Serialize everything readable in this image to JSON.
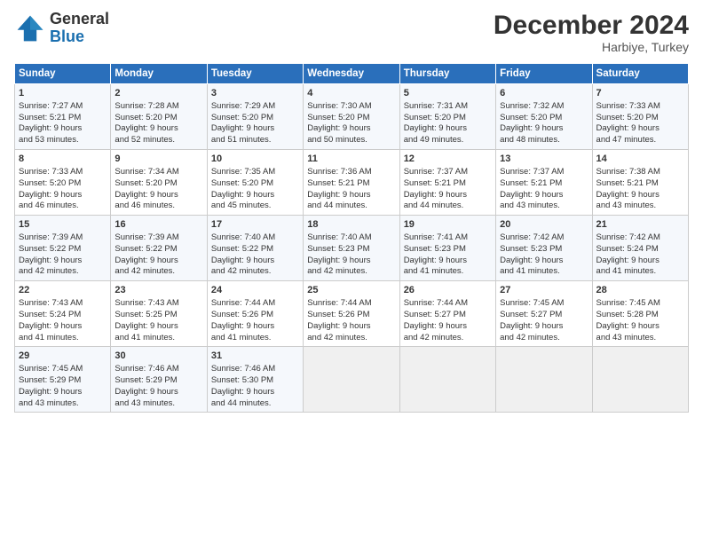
{
  "header": {
    "logo_text_general": "General",
    "logo_text_blue": "Blue",
    "month_title": "December 2024",
    "subtitle": "Harbiye, Turkey"
  },
  "columns": [
    "Sunday",
    "Monday",
    "Tuesday",
    "Wednesday",
    "Thursday",
    "Friday",
    "Saturday"
  ],
  "weeks": [
    [
      {
        "day": "1",
        "lines": [
          "Sunrise: 7:27 AM",
          "Sunset: 5:21 PM",
          "Daylight: 9 hours",
          "and 53 minutes."
        ]
      },
      {
        "day": "2",
        "lines": [
          "Sunrise: 7:28 AM",
          "Sunset: 5:20 PM",
          "Daylight: 9 hours",
          "and 52 minutes."
        ]
      },
      {
        "day": "3",
        "lines": [
          "Sunrise: 7:29 AM",
          "Sunset: 5:20 PM",
          "Daylight: 9 hours",
          "and 51 minutes."
        ]
      },
      {
        "day": "4",
        "lines": [
          "Sunrise: 7:30 AM",
          "Sunset: 5:20 PM",
          "Daylight: 9 hours",
          "and 50 minutes."
        ]
      },
      {
        "day": "5",
        "lines": [
          "Sunrise: 7:31 AM",
          "Sunset: 5:20 PM",
          "Daylight: 9 hours",
          "and 49 minutes."
        ]
      },
      {
        "day": "6",
        "lines": [
          "Sunrise: 7:32 AM",
          "Sunset: 5:20 PM",
          "Daylight: 9 hours",
          "and 48 minutes."
        ]
      },
      {
        "day": "7",
        "lines": [
          "Sunrise: 7:33 AM",
          "Sunset: 5:20 PM",
          "Daylight: 9 hours",
          "and 47 minutes."
        ]
      }
    ],
    [
      {
        "day": "8",
        "lines": [
          "Sunrise: 7:33 AM",
          "Sunset: 5:20 PM",
          "Daylight: 9 hours",
          "and 46 minutes."
        ]
      },
      {
        "day": "9",
        "lines": [
          "Sunrise: 7:34 AM",
          "Sunset: 5:20 PM",
          "Daylight: 9 hours",
          "and 46 minutes."
        ]
      },
      {
        "day": "10",
        "lines": [
          "Sunrise: 7:35 AM",
          "Sunset: 5:20 PM",
          "Daylight: 9 hours",
          "and 45 minutes."
        ]
      },
      {
        "day": "11",
        "lines": [
          "Sunrise: 7:36 AM",
          "Sunset: 5:21 PM",
          "Daylight: 9 hours",
          "and 44 minutes."
        ]
      },
      {
        "day": "12",
        "lines": [
          "Sunrise: 7:37 AM",
          "Sunset: 5:21 PM",
          "Daylight: 9 hours",
          "and 44 minutes."
        ]
      },
      {
        "day": "13",
        "lines": [
          "Sunrise: 7:37 AM",
          "Sunset: 5:21 PM",
          "Daylight: 9 hours",
          "and 43 minutes."
        ]
      },
      {
        "day": "14",
        "lines": [
          "Sunrise: 7:38 AM",
          "Sunset: 5:21 PM",
          "Daylight: 9 hours",
          "and 43 minutes."
        ]
      }
    ],
    [
      {
        "day": "15",
        "lines": [
          "Sunrise: 7:39 AM",
          "Sunset: 5:22 PM",
          "Daylight: 9 hours",
          "and 42 minutes."
        ]
      },
      {
        "day": "16",
        "lines": [
          "Sunrise: 7:39 AM",
          "Sunset: 5:22 PM",
          "Daylight: 9 hours",
          "and 42 minutes."
        ]
      },
      {
        "day": "17",
        "lines": [
          "Sunrise: 7:40 AM",
          "Sunset: 5:22 PM",
          "Daylight: 9 hours",
          "and 42 minutes."
        ]
      },
      {
        "day": "18",
        "lines": [
          "Sunrise: 7:40 AM",
          "Sunset: 5:23 PM",
          "Daylight: 9 hours",
          "and 42 minutes."
        ]
      },
      {
        "day": "19",
        "lines": [
          "Sunrise: 7:41 AM",
          "Sunset: 5:23 PM",
          "Daylight: 9 hours",
          "and 41 minutes."
        ]
      },
      {
        "day": "20",
        "lines": [
          "Sunrise: 7:42 AM",
          "Sunset: 5:23 PM",
          "Daylight: 9 hours",
          "and 41 minutes."
        ]
      },
      {
        "day": "21",
        "lines": [
          "Sunrise: 7:42 AM",
          "Sunset: 5:24 PM",
          "Daylight: 9 hours",
          "and 41 minutes."
        ]
      }
    ],
    [
      {
        "day": "22",
        "lines": [
          "Sunrise: 7:43 AM",
          "Sunset: 5:24 PM",
          "Daylight: 9 hours",
          "and 41 minutes."
        ]
      },
      {
        "day": "23",
        "lines": [
          "Sunrise: 7:43 AM",
          "Sunset: 5:25 PM",
          "Daylight: 9 hours",
          "and 41 minutes."
        ]
      },
      {
        "day": "24",
        "lines": [
          "Sunrise: 7:44 AM",
          "Sunset: 5:26 PM",
          "Daylight: 9 hours",
          "and 41 minutes."
        ]
      },
      {
        "day": "25",
        "lines": [
          "Sunrise: 7:44 AM",
          "Sunset: 5:26 PM",
          "Daylight: 9 hours",
          "and 42 minutes."
        ]
      },
      {
        "day": "26",
        "lines": [
          "Sunrise: 7:44 AM",
          "Sunset: 5:27 PM",
          "Daylight: 9 hours",
          "and 42 minutes."
        ]
      },
      {
        "day": "27",
        "lines": [
          "Sunrise: 7:45 AM",
          "Sunset: 5:27 PM",
          "Daylight: 9 hours",
          "and 42 minutes."
        ]
      },
      {
        "day": "28",
        "lines": [
          "Sunrise: 7:45 AM",
          "Sunset: 5:28 PM",
          "Daylight: 9 hours",
          "and 43 minutes."
        ]
      }
    ],
    [
      {
        "day": "29",
        "lines": [
          "Sunrise: 7:45 AM",
          "Sunset: 5:29 PM",
          "Daylight: 9 hours",
          "and 43 minutes."
        ]
      },
      {
        "day": "30",
        "lines": [
          "Sunrise: 7:46 AM",
          "Sunset: 5:29 PM",
          "Daylight: 9 hours",
          "and 43 minutes."
        ]
      },
      {
        "day": "31",
        "lines": [
          "Sunrise: 7:46 AM",
          "Sunset: 5:30 PM",
          "Daylight: 9 hours",
          "and 44 minutes."
        ]
      },
      null,
      null,
      null,
      null
    ]
  ]
}
